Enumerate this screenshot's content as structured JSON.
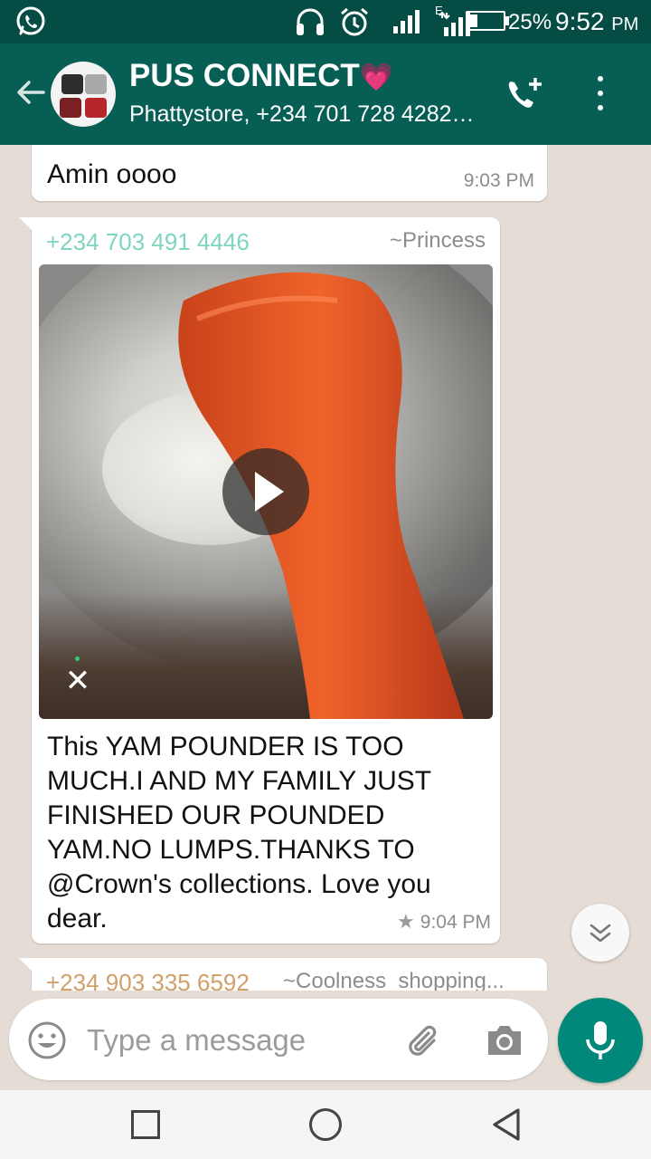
{
  "status_bar": {
    "battery_percent": "25%",
    "battery_level": 0.25,
    "time": "9:52",
    "ampm": "PM",
    "network_label": "E",
    "icons": [
      "whatsapp-icon",
      "headset-icon",
      "alarm-icon",
      "signal-icon",
      "signal-e-icon",
      "battery-icon"
    ]
  },
  "header": {
    "title": "PUS CONNECT",
    "title_emoji": "💗",
    "subtitle": "Phattystore, +234 701 728 4282…",
    "icons": [
      "back-arrow-icon",
      "add-call-icon",
      "more-vert-icon"
    ]
  },
  "messages": [
    {
      "text": "Amin oooo",
      "time": "9:03 PM"
    },
    {
      "sender": "+234 703 491 4446",
      "alias": "~Princess",
      "media": "video",
      "caption": "This YAM POUNDER IS TOO MUCH.I  AND MY FAMILY JUST FINISHED OUR POUNDED YAM.NO LUMPS.THANKS TO @Crown's collections. Love you dear.",
      "starred": true,
      "time": "9:04 PM"
    },
    {
      "sender": "+234 903 335 6592",
      "alias": "~Coolness_shopping..."
    }
  ],
  "composer": {
    "placeholder": "Type a message",
    "icons": [
      "emoji-icon",
      "paperclip-icon",
      "camera-icon",
      "mic-icon"
    ]
  },
  "colors": {
    "status_bar": "#054d44",
    "header": "#075e54",
    "chat_bg": "#e5ddd5",
    "accent": "#00897b",
    "sender_1": "#7fd5c1",
    "sender_2": "#d09f6a"
  }
}
